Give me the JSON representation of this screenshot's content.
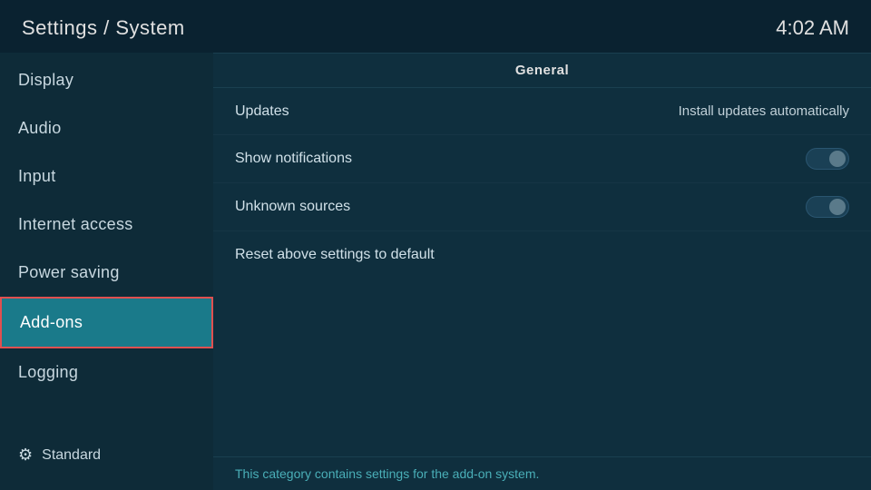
{
  "header": {
    "title": "Settings / System",
    "time": "4:02 AM"
  },
  "sidebar": {
    "items": [
      {
        "id": "display",
        "label": "Display",
        "active": false
      },
      {
        "id": "audio",
        "label": "Audio",
        "active": false
      },
      {
        "id": "input",
        "label": "Input",
        "active": false
      },
      {
        "id": "internet-access",
        "label": "Internet access",
        "active": false
      },
      {
        "id": "power-saving",
        "label": "Power saving",
        "active": false
      },
      {
        "id": "add-ons",
        "label": "Add-ons",
        "active": true
      },
      {
        "id": "logging",
        "label": "Logging",
        "active": false
      }
    ],
    "footer_label": "Standard"
  },
  "content": {
    "section_title": "General",
    "settings": [
      {
        "id": "updates",
        "label": "Updates",
        "value": "Install updates automatically",
        "type": "value"
      },
      {
        "id": "show-notifications",
        "label": "Show notifications",
        "value": "",
        "type": "toggle"
      },
      {
        "id": "unknown-sources",
        "label": "Unknown sources",
        "value": "",
        "type": "toggle"
      },
      {
        "id": "reset-settings",
        "label": "Reset above settings to default",
        "value": "",
        "type": "none"
      }
    ],
    "footer_text": "This category contains settings for the add-on system."
  }
}
